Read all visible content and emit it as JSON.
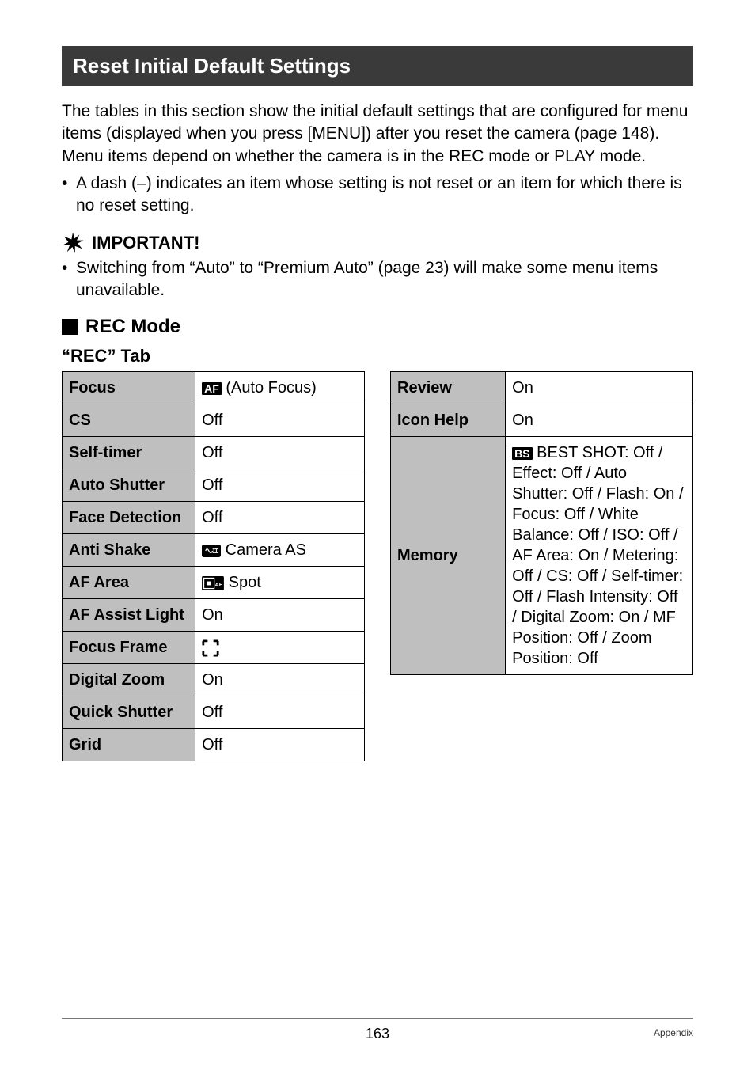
{
  "title": "Reset Initial Default Settings",
  "intro": "The tables in this section show the initial default settings that are configured for menu items (displayed when you press [MENU]) after you reset the camera (page 148). Menu items depend on whether the camera is in the REC mode or PLAY mode.",
  "dash_note": "A dash (–) indicates an item whose setting is not reset or an item for which there is no reset setting.",
  "important_label": "IMPORTANT!",
  "important_note": "Switching from “Auto” to “Premium Auto” (page 23) will make some menu items unavailable.",
  "mode_heading": "REC Mode",
  "tab_heading": "“REC” Tab",
  "left": {
    "focus_k": "Focus",
    "focus_v": "(Auto Focus)",
    "cs_k": "CS",
    "cs_v": "Off",
    "selftimer_k": "Self-timer",
    "selftimer_v": "Off",
    "autoshutter_k": "Auto Shutter",
    "autoshutter_v": "Off",
    "facedet_k": "Face Detection",
    "facedet_v": "Off",
    "antishake_k": "Anti Shake",
    "antishake_v": "Camera AS",
    "afarea_k": "AF Area",
    "afarea_v": "Spot",
    "afassist_k": "AF Assist Light",
    "afassist_v": "On",
    "focusframe_k": "Focus Frame",
    "focusframe_v": "",
    "digitalzoom_k": "Digital Zoom",
    "digitalzoom_v": "On",
    "quickshutter_k": "Quick Shutter",
    "quickshutter_v": "Off",
    "grid_k": "Grid",
    "grid_v": "Off"
  },
  "right": {
    "review_k": "Review",
    "review_v": "On",
    "iconhelp_k": "Icon Help",
    "iconhelp_v": "On",
    "memory_k": "Memory",
    "memory_v": " BEST SHOT: Off / Effect: Off / Auto Shutter: Off / Flash: On / Focus: Off / White Balance: Off / ISO: Off / AF Area: On / Metering: Off / CS: Off / Self-timer: Off / Flash Intensity: Off / Digital Zoom: On / MF Position: Off / Zoom Position: Off"
  },
  "icons": {
    "af": "AF",
    "bs": "BS"
  },
  "footer": {
    "page": "163",
    "section": "Appendix"
  }
}
